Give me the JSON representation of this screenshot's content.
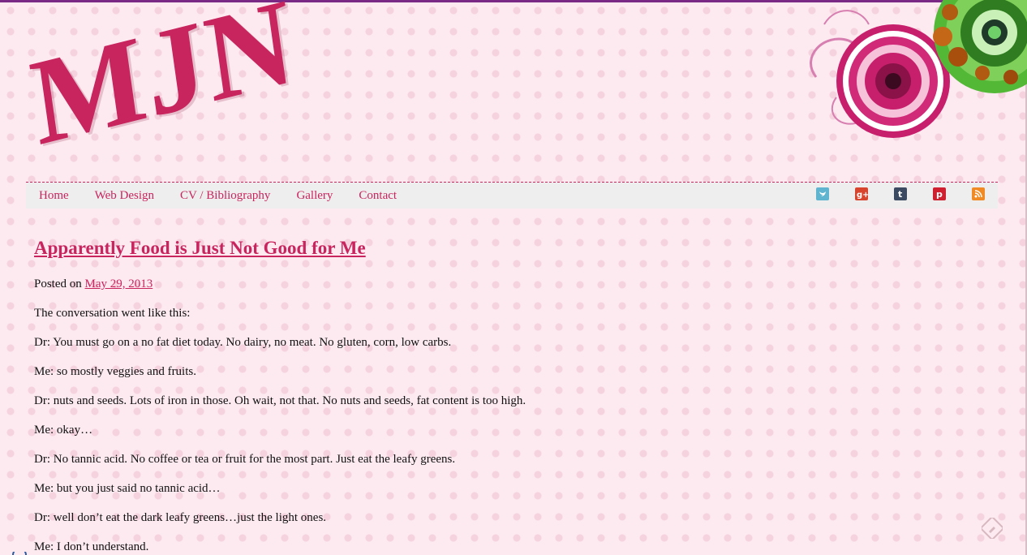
{
  "logo": {
    "text": "MJN"
  },
  "nav": {
    "items": [
      {
        "label": "Home"
      },
      {
        "label": "Web Design"
      },
      {
        "label": "CV / Bibliography"
      },
      {
        "label": "Gallery"
      },
      {
        "label": "Contact"
      }
    ],
    "social_icons": [
      "twitter-icon",
      "google-plus-icon",
      "tumblr-icon",
      "pinterest-icon",
      "rss-icon"
    ]
  },
  "post": {
    "title": "Apparently Food is Just Not Good for Me",
    "posted_prefix": "Posted on",
    "date": "May 29, 2013",
    "paragraphs": [
      "The conversation went like this:",
      "Dr: You must go on a no fat diet today. No dairy, no meat. No gluten, corn, low carbs.",
      "Me: so mostly veggies and fruits.",
      "Dr: nuts and seeds. Lots of iron in those. Oh wait, not that. No nuts and seeds, fat content is too high.",
      "Me: okay…",
      "Dr: No tannic acid. No coffee or tea or fruit for the most part. Just eat the leafy greens.",
      "Me: but you just said no tannic acid…",
      "Dr: well don’t eat the dark leafy greens…just the light ones.",
      "Me: I don’t understand."
    ]
  },
  "colors": {
    "accent": "#c8245e",
    "background": "#fdeaf0",
    "nav_bg": "#efeeee",
    "top_border": "#7a2a84"
  }
}
